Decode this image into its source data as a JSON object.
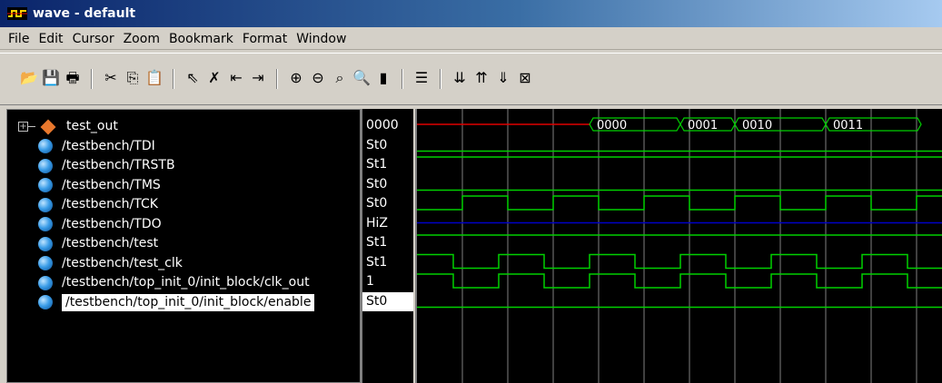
{
  "window": {
    "title": "wave - default"
  },
  "menu": [
    "File",
    "Edit",
    "Cursor",
    "Zoom",
    "Bookmark",
    "Format",
    "Window"
  ],
  "toolbar": {
    "buttons": [
      {
        "name": "open-icon",
        "glyph": "📂"
      },
      {
        "name": "save-icon",
        "glyph": "💾"
      },
      {
        "name": "print-icon",
        "glyph": "🖶"
      },
      {
        "sep": true
      },
      {
        "name": "cut-icon",
        "glyph": "✂"
      },
      {
        "name": "copy-icon",
        "glyph": "⎘"
      },
      {
        "name": "paste-icon",
        "glyph": "📋"
      },
      {
        "sep": true
      },
      {
        "name": "select-pointer-icon",
        "glyph": "⇖"
      },
      {
        "name": "delete-cursor-icon",
        "glyph": "✗"
      },
      {
        "name": "cursor-left-icon",
        "glyph": "⇤"
      },
      {
        "name": "cursor-right-icon",
        "glyph": "⇥"
      },
      {
        "sep": true
      },
      {
        "name": "zoom-in-icon",
        "glyph": "⊕"
      },
      {
        "name": "zoom-out-icon",
        "glyph": "⊖"
      },
      {
        "name": "zoom-full-icon",
        "glyph": "⌕"
      },
      {
        "name": "zoom-area-icon",
        "glyph": "🔍"
      },
      {
        "name": "stop-icon",
        "glyph": "▮"
      },
      {
        "sep": true
      },
      {
        "name": "find-icon",
        "glyph": "☰"
      },
      {
        "sep": true
      },
      {
        "name": "prev-edge-icon",
        "glyph": "⇊"
      },
      {
        "name": "next-edge-icon",
        "glyph": "⇈"
      },
      {
        "name": "edge-down-icon",
        "glyph": "⇓"
      },
      {
        "name": "clear-icon",
        "glyph": "⊠"
      }
    ]
  },
  "signals": [
    {
      "label": "test_out",
      "value": "0000",
      "type": "bus"
    },
    {
      "label": "/testbench/TDI",
      "value": "St0",
      "type": "wire"
    },
    {
      "label": "/testbench/TRSTB",
      "value": "St1",
      "type": "wire"
    },
    {
      "label": "/testbench/TMS",
      "value": "St0",
      "type": "wire"
    },
    {
      "label": "/testbench/TCK",
      "value": "St0",
      "type": "wire"
    },
    {
      "label": "/testbench/TDO",
      "value": "HiZ",
      "type": "wire"
    },
    {
      "label": "/testbench/test",
      "value": "St1",
      "type": "wire"
    },
    {
      "label": "/testbench/test_clk",
      "value": "St1",
      "type": "wire"
    },
    {
      "label": "/testbench/top_init_0/init_block/clk_out",
      "value": "1",
      "type": "wire"
    },
    {
      "label": "/testbench/top_init_0/init_block/enable",
      "value": "St0",
      "type": "wire",
      "selected": true
    }
  ],
  "bus_values": [
    "0000",
    "0001",
    "0010",
    "0011"
  ],
  "colors": {
    "wave": "#00d000",
    "undefined": "#e00000",
    "hiz": "#0000c8",
    "grid": "#808080"
  }
}
